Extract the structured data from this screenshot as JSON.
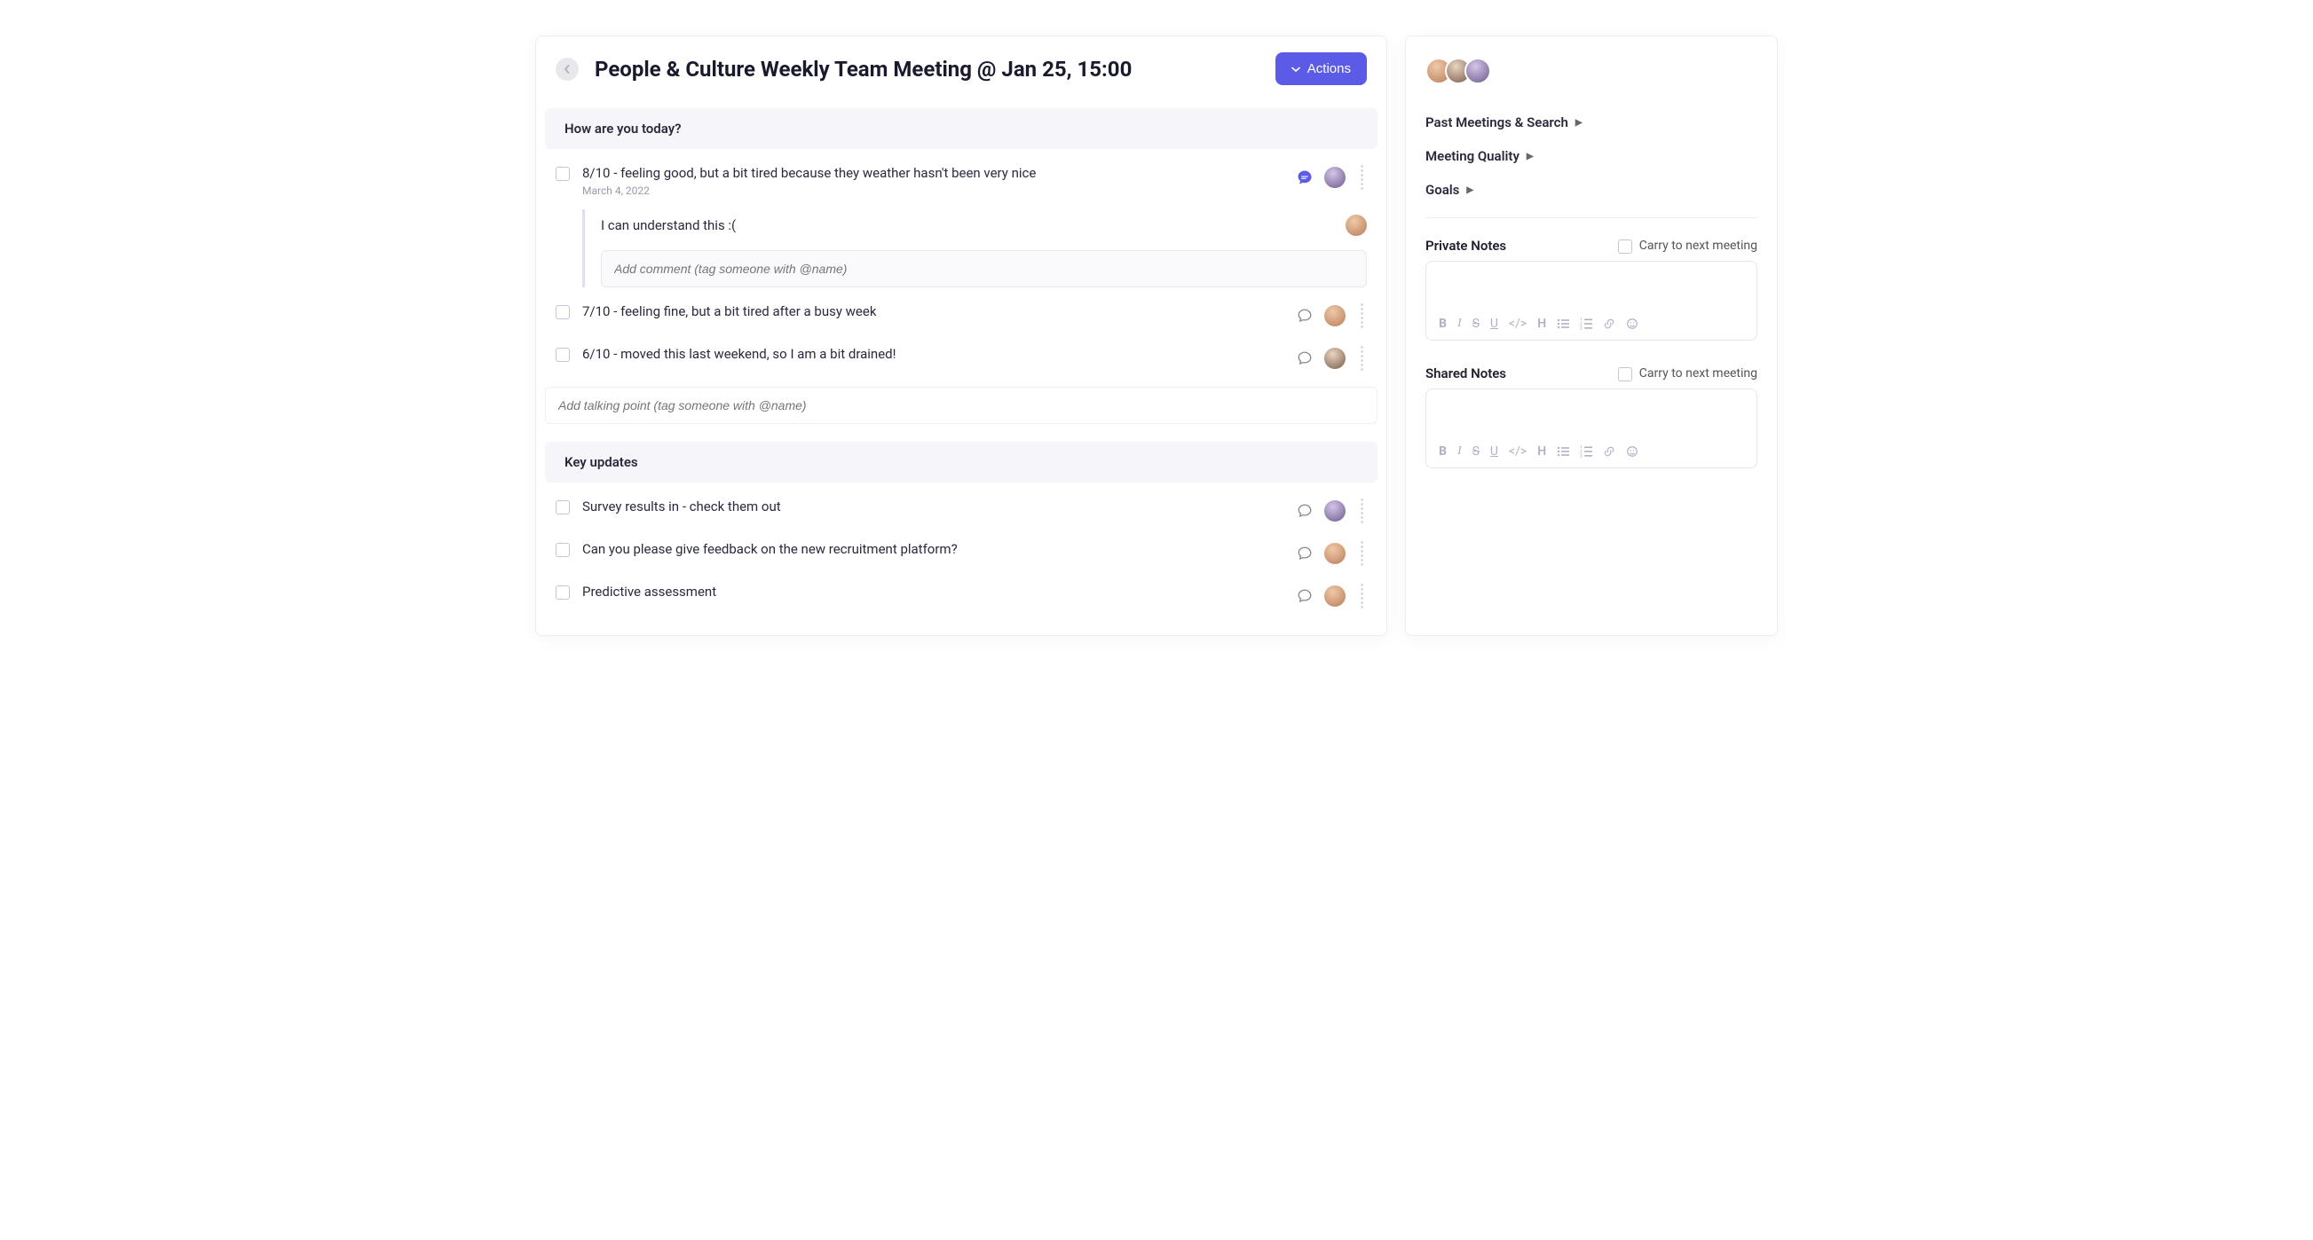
{
  "header": {
    "title": "People & Culture Weekly Team Meeting @ Jan 25, 15:00",
    "actions_label": "Actions"
  },
  "sections": [
    {
      "title": "How are you today?",
      "items": [
        {
          "text": "8/10 - feeling good, but a bit tired because they weather hasn't been very nice",
          "date": "March 4, 2022",
          "has_comments": true,
          "replies": [
            {
              "text": "I can understand this :("
            }
          ]
        },
        {
          "text": "7/10 - feeling fine, but a bit tired after a busy week",
          "has_comments": false
        },
        {
          "text": "6/10 - moved this last weekend, so I am a bit drained!",
          "has_comments": false
        }
      ],
      "comment_placeholder": "Add comment (tag someone with @name)",
      "add_placeholder": "Add talking point (tag someone with @name)"
    },
    {
      "title": "Key updates",
      "items": [
        {
          "text": "Survey results in - check them out",
          "has_comments": false
        },
        {
          "text": "Can you please give feedback on the new recruitment platform?",
          "has_comments": false
        },
        {
          "text": "Predictive assessment",
          "has_comments": false
        }
      ]
    }
  ],
  "sidebar": {
    "links": [
      {
        "label": "Past Meetings & Search"
      },
      {
        "label": "Meeting Quality"
      },
      {
        "label": "Goals"
      }
    ],
    "private_notes_label": "Private Notes",
    "shared_notes_label": "Shared Notes",
    "carry_label": "Carry to next meeting"
  }
}
